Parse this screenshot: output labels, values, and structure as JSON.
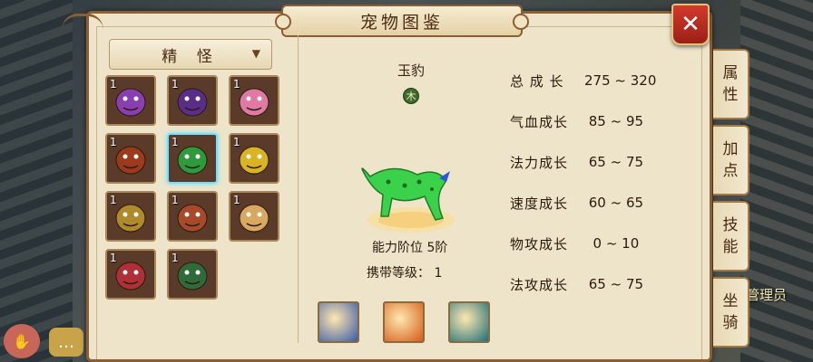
{
  "window": {
    "title": "宠物图鉴",
    "close_label": "✕"
  },
  "filter": {
    "selected": "精 怪"
  },
  "pets": [
    {
      "count": "1",
      "name": "sword-spirit",
      "color": "#8a3fb0"
    },
    {
      "count": "1",
      "name": "purple-leopard",
      "color": "#5b2d8a"
    },
    {
      "count": "1",
      "name": "pink-deer",
      "color": "#e07aa4"
    },
    {
      "count": "1",
      "name": "gourd-red",
      "color": "#9c3b1c"
    },
    {
      "count": "1",
      "name": "green-leopard",
      "color": "#2f9a3c",
      "selected": true
    },
    {
      "count": "1",
      "name": "gourd-gold",
      "color": "#d9b322"
    },
    {
      "count": "1",
      "name": "gold-beast",
      "color": "#b08a2a"
    },
    {
      "count": "1",
      "name": "red-sword-spirit",
      "color": "#a84a2a"
    },
    {
      "count": "1",
      "name": "golden-deer",
      "color": "#d8a860"
    },
    {
      "count": "1",
      "name": "red-lion",
      "color": "#b0303a"
    },
    {
      "count": "1",
      "name": "green-lion",
      "color": "#2f6b3a"
    }
  ],
  "detail": {
    "name": "玉豹",
    "element": "木",
    "ability": "能力阶位 5阶",
    "carry_level": "携带等级： 1"
  },
  "stats": [
    {
      "label": "总 成 长",
      "value": "275 ~ 320"
    },
    {
      "label": "气血成长",
      "value": " 85 ~ 95"
    },
    {
      "label": "法力成长",
      "value": " 65 ~ 75"
    },
    {
      "label": "速度成长",
      "value": " 60 ~ 65"
    },
    {
      "label": "物攻成长",
      "value": "  0 ~ 10"
    },
    {
      "label": "法攻成长",
      "value": " 65 ~ 75"
    }
  ],
  "skills": [
    {
      "name": "claw-skill-icon",
      "color": "#3a5aa8"
    },
    {
      "name": "fire-skill-icon",
      "color": "#d45a18"
    },
    {
      "name": "ring-skill-icon",
      "color": "#1e6f78"
    }
  ],
  "tabs": [
    {
      "label": "属性",
      "active": false
    },
    {
      "label": "加点",
      "active": false
    },
    {
      "label": "技能",
      "active": false
    },
    {
      "label": "坐骑",
      "active": false
    }
  ],
  "world": {
    "npc_label": "管理员"
  }
}
